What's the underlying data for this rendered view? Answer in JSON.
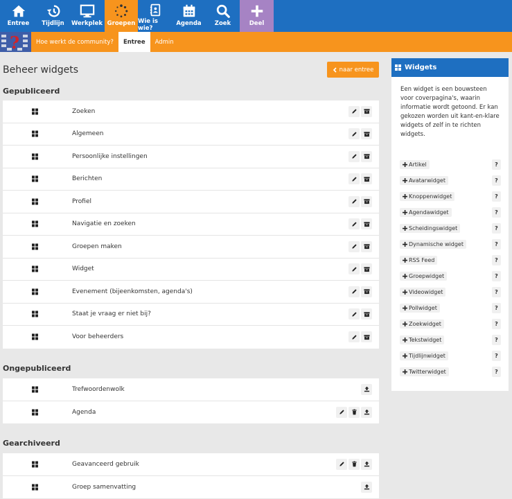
{
  "nav": {
    "items": [
      {
        "label": "Entree",
        "icon": "home-icon"
      },
      {
        "label": "Tijdlijn",
        "icon": "history-icon"
      },
      {
        "label": "Werkplek",
        "icon": "monitor-icon"
      },
      {
        "label": "Groepen",
        "icon": "spinner-icon"
      },
      {
        "label": "Wie is wie?",
        "icon": "address-book-icon"
      },
      {
        "label": "Agenda",
        "icon": "calendar-icon"
      },
      {
        "label": "Zoek",
        "icon": "search-icon"
      },
      {
        "label": "Deel",
        "icon": "plus-icon"
      }
    ],
    "active_color": "#f7941d",
    "bar_color": "#1e6fc1",
    "deel_color": "#a683c4"
  },
  "subnav": {
    "community_link": "Hoe werkt de community?",
    "entree": "Entree",
    "admin": "Admin"
  },
  "main": {
    "title": "Beheer widgets",
    "back_button": "naar entree",
    "published": {
      "title": "Gepubliceerd",
      "rows": [
        "Zoeken",
        "Algemeen",
        "Persoonlijke instellingen",
        "Berichten",
        "Profiel",
        "Navigatie en zoeken",
        "Groepen maken",
        "Widget",
        "Evenement (bijeenkomsten, agenda's)",
        "Staat je vraag er niet bij?",
        "Voor beheerders"
      ]
    },
    "unpublished": {
      "title": "Ongepubliceerd",
      "rows": [
        "Trefwoordenwolk",
        "Agenda"
      ]
    },
    "archived": {
      "title": "Gearchiveerd",
      "rows": [
        "Geavanceerd gebruik",
        "Groep samenvatting"
      ]
    }
  },
  "sidebar": {
    "title": "Widgets",
    "description": "Een widget is een bouwsteen voor coverpagina's, waarin informatie wordt getoond. Er kan gekozen worden uit kant-en-klare widgets of zelf in te richten widgets.",
    "items": [
      "Artikel",
      "Avatarwidget",
      "Knoppenwidget",
      "Agendawidget",
      "Scheidingswidget",
      "Dynamische widget",
      "RSS Feed",
      "Groepwidget",
      "Videowidget",
      "Pollwidget",
      "Zoekwidget",
      "Tekstwidget",
      "Tijdlijnwidget",
      "Twitterwidget"
    ],
    "help_label": "?"
  }
}
